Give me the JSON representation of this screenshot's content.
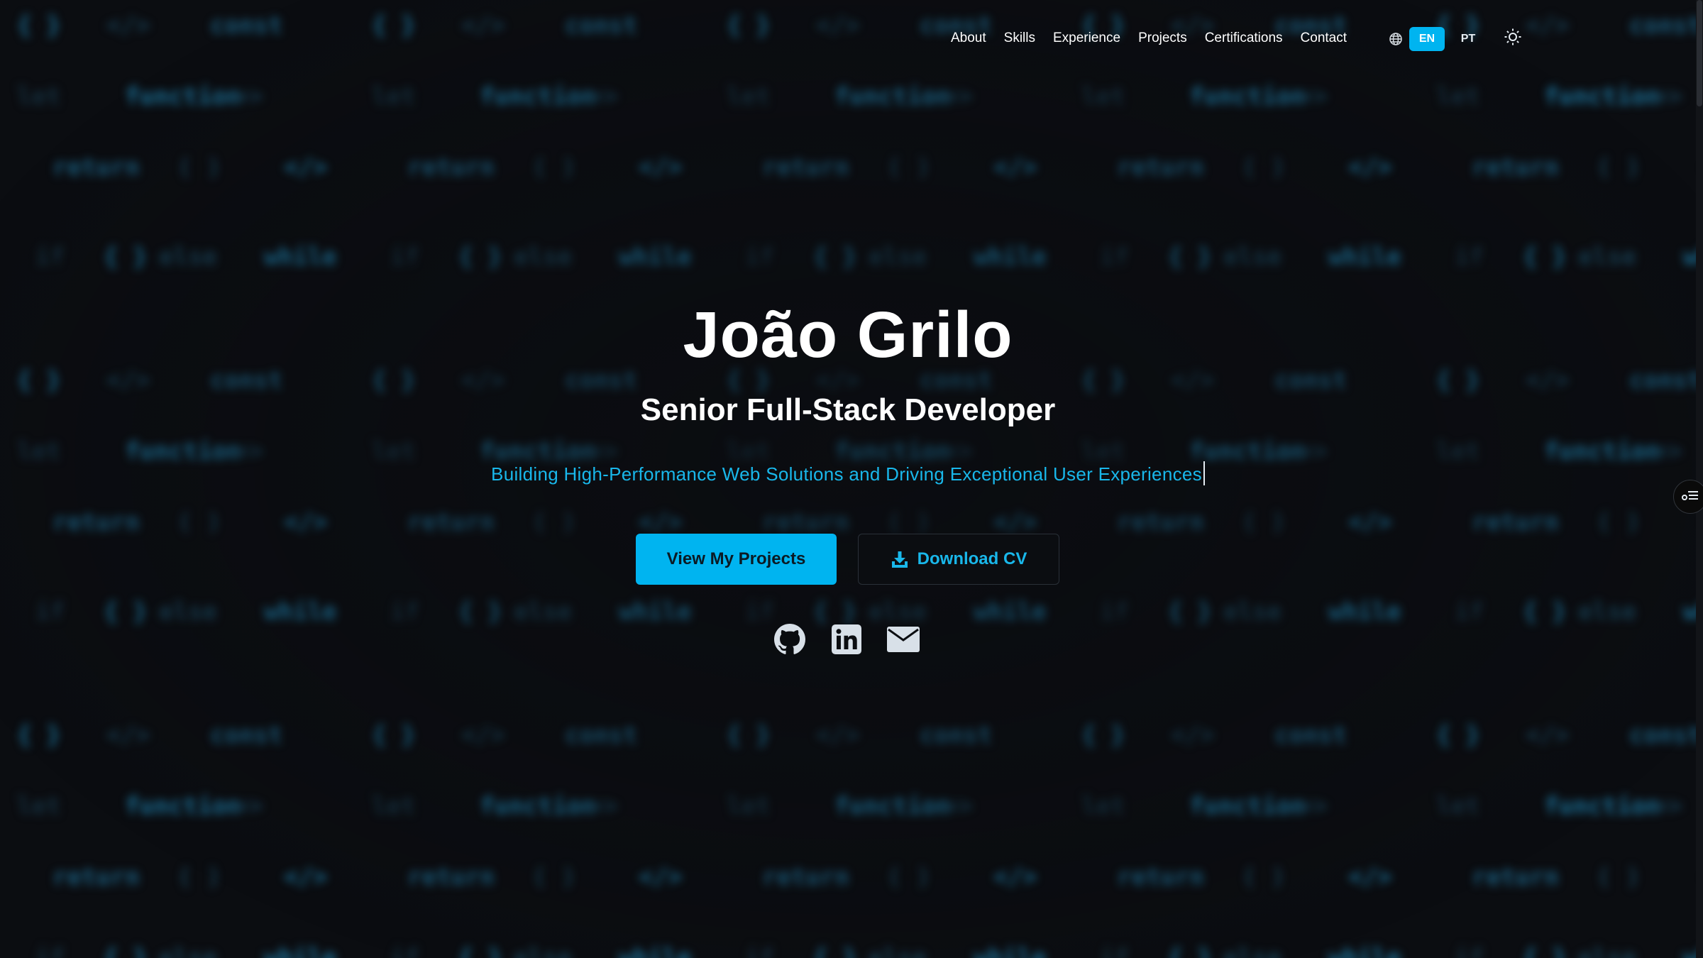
{
  "nav": {
    "links": [
      "About",
      "Skills",
      "Experience",
      "Projects",
      "Certifications",
      "Contact"
    ],
    "languages": [
      "EN",
      "PT"
    ],
    "active_language": "EN"
  },
  "hero": {
    "name": "João Grilo",
    "title": "Senior Full-Stack Developer",
    "tagline": "Building High-Performance Web Solutions and Driving Exceptional User Experiences",
    "primary_button": "View My Projects",
    "secondary_button": "Download CV"
  },
  "socials": [
    "github-icon",
    "linkedin-icon",
    "email-icon"
  ],
  "background_code_tokens": [
    [
      "{ }",
      "</>",
      "const"
    ],
    [
      "let",
      "function",
      "=>"
    ],
    [
      "return",
      "( )",
      "</>"
    ],
    [
      "if",
      "{ }",
      "else",
      "while"
    ]
  ],
  "colors": {
    "background": "#0b0d11",
    "accent": "#00b4f0",
    "accent_text": "#19b7ea",
    "text": "#ffffff"
  }
}
